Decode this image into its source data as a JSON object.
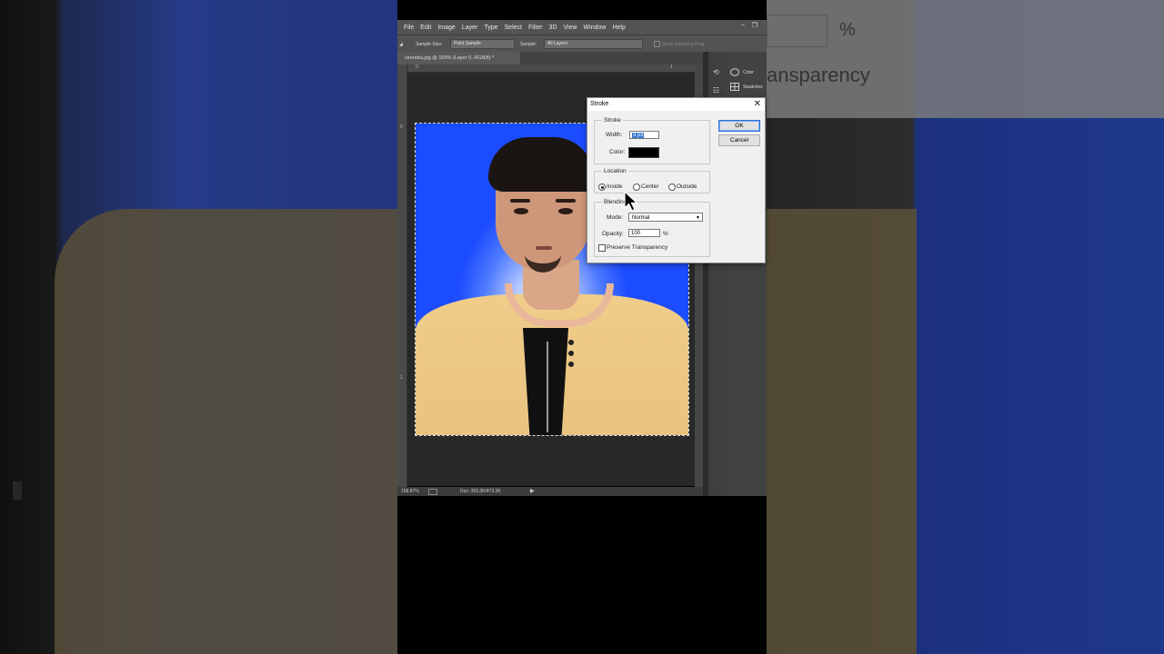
{
  "menu": [
    "File",
    "Edit",
    "Image",
    "Layer",
    "Type",
    "Select",
    "Filter",
    "3D",
    "View",
    "Window",
    "Help"
  ],
  "options_bar": {
    "sample_size_label": "Sample Size:",
    "sample_size_value": "Point Sample",
    "sample_label": "Sample:",
    "sample_value": "All Layers",
    "show_ring": "Show Sampling Ring"
  },
  "document_tab": "virendra.jpg @ 159% (Layer 0, RGB/8) *",
  "ruler": {
    "h0": "0",
    "h1": "1",
    "v0": "0",
    "v1": "1"
  },
  "status": {
    "zoom": "158.87%",
    "doc": "Doc: 353.3K/473.3K"
  },
  "panels": [
    {
      "name": "Color",
      "icon": "color-palette-icon"
    },
    {
      "name": "Swatches",
      "icon": "swatches-grid-icon"
    }
  ],
  "dialog": {
    "title": "Stroke",
    "stroke_group": "Stroke",
    "width_label": "Width:",
    "width_value": "3 px",
    "color_label": "Color:",
    "color_value": "#000000",
    "location_group": "Location",
    "location_options": [
      "Inside",
      "Center",
      "Outside"
    ],
    "location_selected": "Inside",
    "blending_group": "Blending",
    "mode_label": "Mode:",
    "mode_value": "Normal",
    "opacity_label": "Opacity:",
    "opacity_value": "100",
    "opacity_unit": "%",
    "preserve_label": "Preserve Transparency",
    "preserve_checked": false,
    "ok": "OK",
    "cancel": "Cancel"
  },
  "background_ghost": {
    "percent": "%",
    "text": "ansparency"
  },
  "colors": {
    "canvas_bg": "#282828",
    "photo_bg_blue": "#1c4cff",
    "stroke_color": "#000000"
  }
}
